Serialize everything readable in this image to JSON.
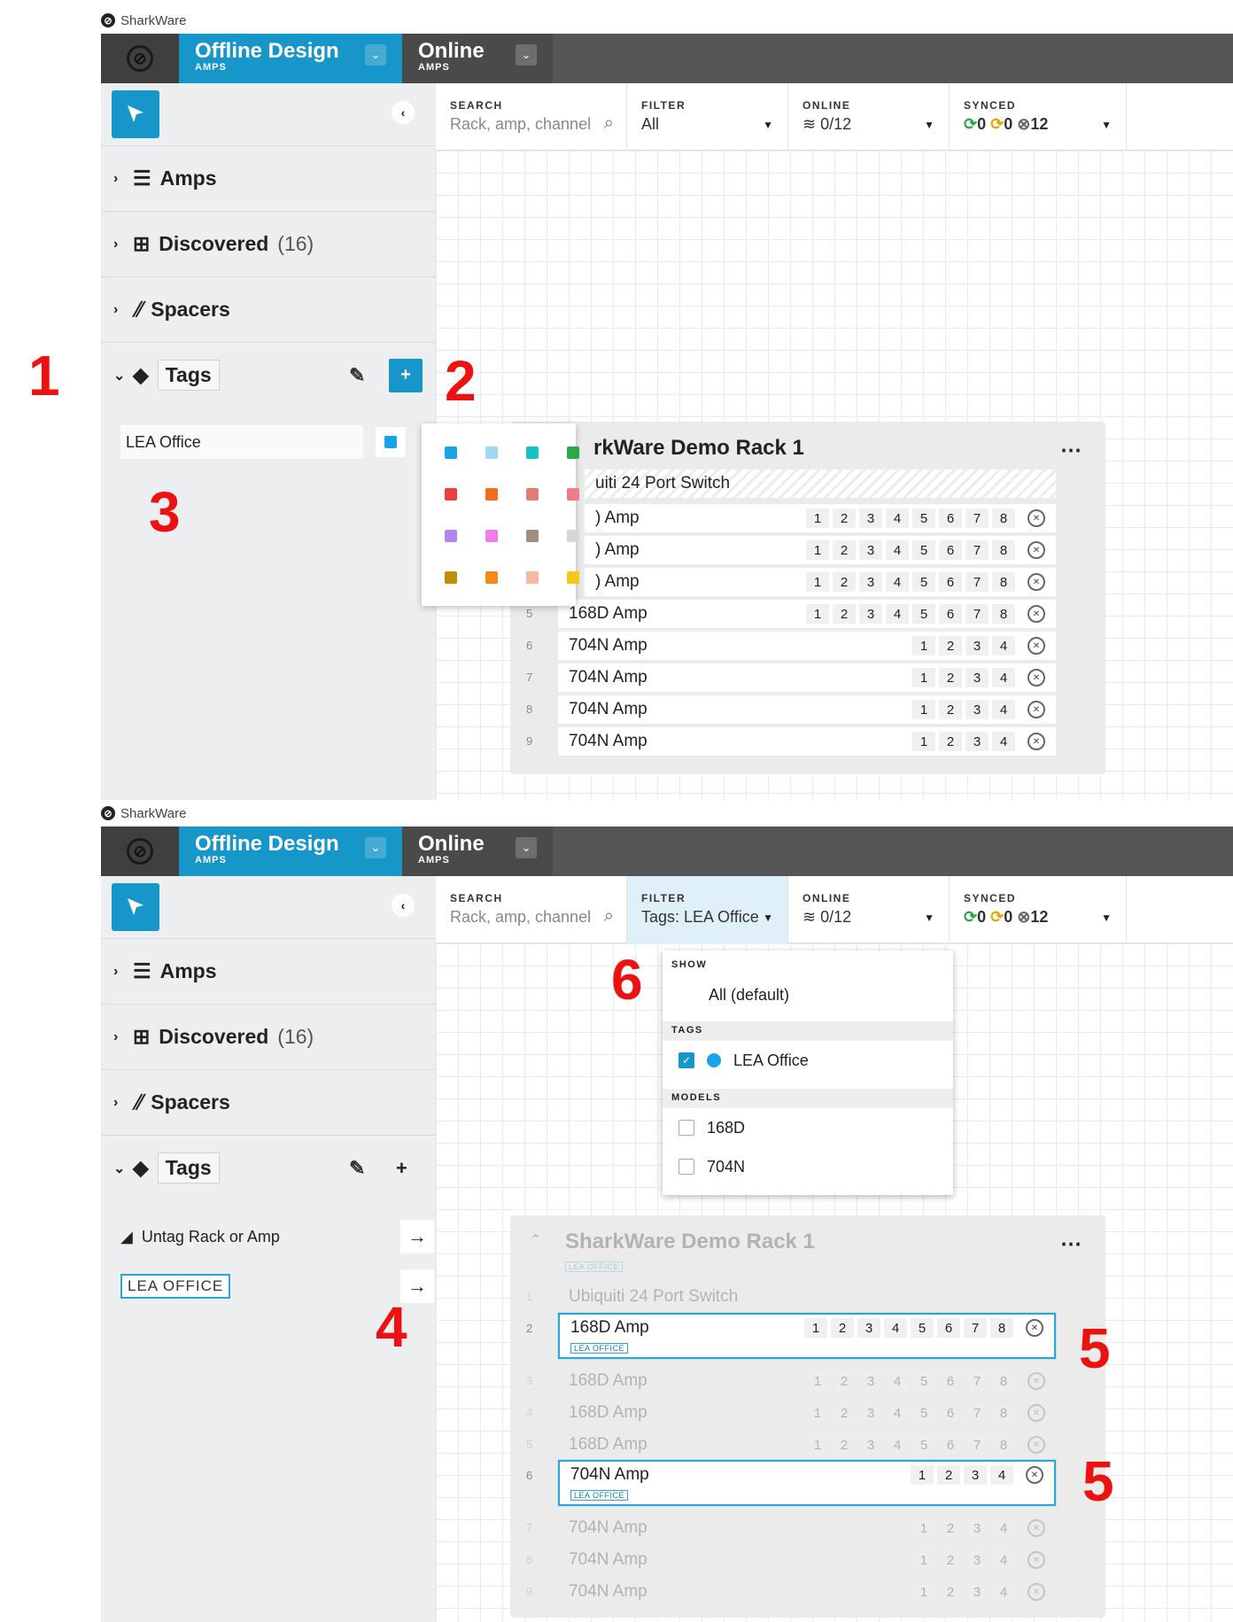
{
  "app": {
    "name": "SharkWare"
  },
  "tabs": {
    "offline": {
      "title": "Offline Design",
      "sub": "AMPS"
    },
    "online": {
      "title": "Online",
      "sub": "AMPS"
    }
  },
  "header": {
    "search_label": "SEARCH",
    "search_placeholder": "Rack, amp, channel",
    "filter_label": "FILTER",
    "filter_value_1": "All",
    "filter_value_2": "Tags: LEA Office",
    "online_label": "ONLINE",
    "online_value": "0/12",
    "synced_label": "SYNCED",
    "synced_ok": "0",
    "synced_warn": "0",
    "synced_off": "12"
  },
  "sidebar": {
    "amps": "Amps",
    "discovered": "Discovered",
    "discovered_count": "(16)",
    "spacers": "Spacers",
    "tags": "Tags",
    "tag_name": "LEA Office",
    "untag": "Untag Rack or Amp",
    "tag_upper": "LEA OFFICE"
  },
  "palette_colors": [
    "#1aa3e6",
    "#9fd9ef",
    "#17c2c2",
    "#2aa84a",
    "#e8413d",
    "#f26a1b",
    "#e47b74",
    "#f07a86",
    "#b186f0",
    "#f07ee8",
    "#a38e7e",
    "#d6d6d6",
    "#c08d08",
    "#f58a16",
    "#f5b8a0",
    "#f5c716"
  ],
  "rack": {
    "title_partial": "rkWare Demo Rack 1",
    "title": "SharkWare Demo Rack 1",
    "switch_partial": "uiti 24 Port Switch",
    "switch": "Ubiquiti 24 Port Switch",
    "tag_pill": "LEA OFFICE",
    "slots": [
      {
        "num": "2",
        "name": "168D Amp",
        "partial": ") Amp",
        "channels": [
          "1",
          "2",
          "3",
          "4",
          "5",
          "6",
          "7",
          "8"
        ]
      },
      {
        "num": "3",
        "name": "168D Amp",
        "partial": ") Amp",
        "channels": [
          "1",
          "2",
          "3",
          "4",
          "5",
          "6",
          "7",
          "8"
        ]
      },
      {
        "num": "4",
        "name": "168D Amp",
        "partial": ") Amp",
        "channels": [
          "1",
          "2",
          "3",
          "4",
          "5",
          "6",
          "7",
          "8"
        ]
      },
      {
        "num": "5",
        "name": "168D Amp",
        "channels": [
          "1",
          "2",
          "3",
          "4",
          "5",
          "6",
          "7",
          "8"
        ]
      },
      {
        "num": "6",
        "name": "704N Amp",
        "channels": [
          "1",
          "2",
          "3",
          "4"
        ]
      },
      {
        "num": "7",
        "name": "704N Amp",
        "channels": [
          "1",
          "2",
          "3",
          "4"
        ]
      },
      {
        "num": "8",
        "name": "704N Amp",
        "channels": [
          "1",
          "2",
          "3",
          "4"
        ]
      },
      {
        "num": "9",
        "name": "704N Amp",
        "channels": [
          "1",
          "2",
          "3",
          "4"
        ]
      }
    ],
    "switch_num": "1"
  },
  "dropdown": {
    "show_label": "SHOW",
    "all_default": "All (default)",
    "tags_label": "TAGS",
    "tag_item": "LEA Office",
    "models_label": "MODELS",
    "model_1": "168D",
    "model_2": "704N"
  },
  "callouts": [
    "1",
    "2",
    "3",
    "4",
    "5",
    "5",
    "6"
  ]
}
